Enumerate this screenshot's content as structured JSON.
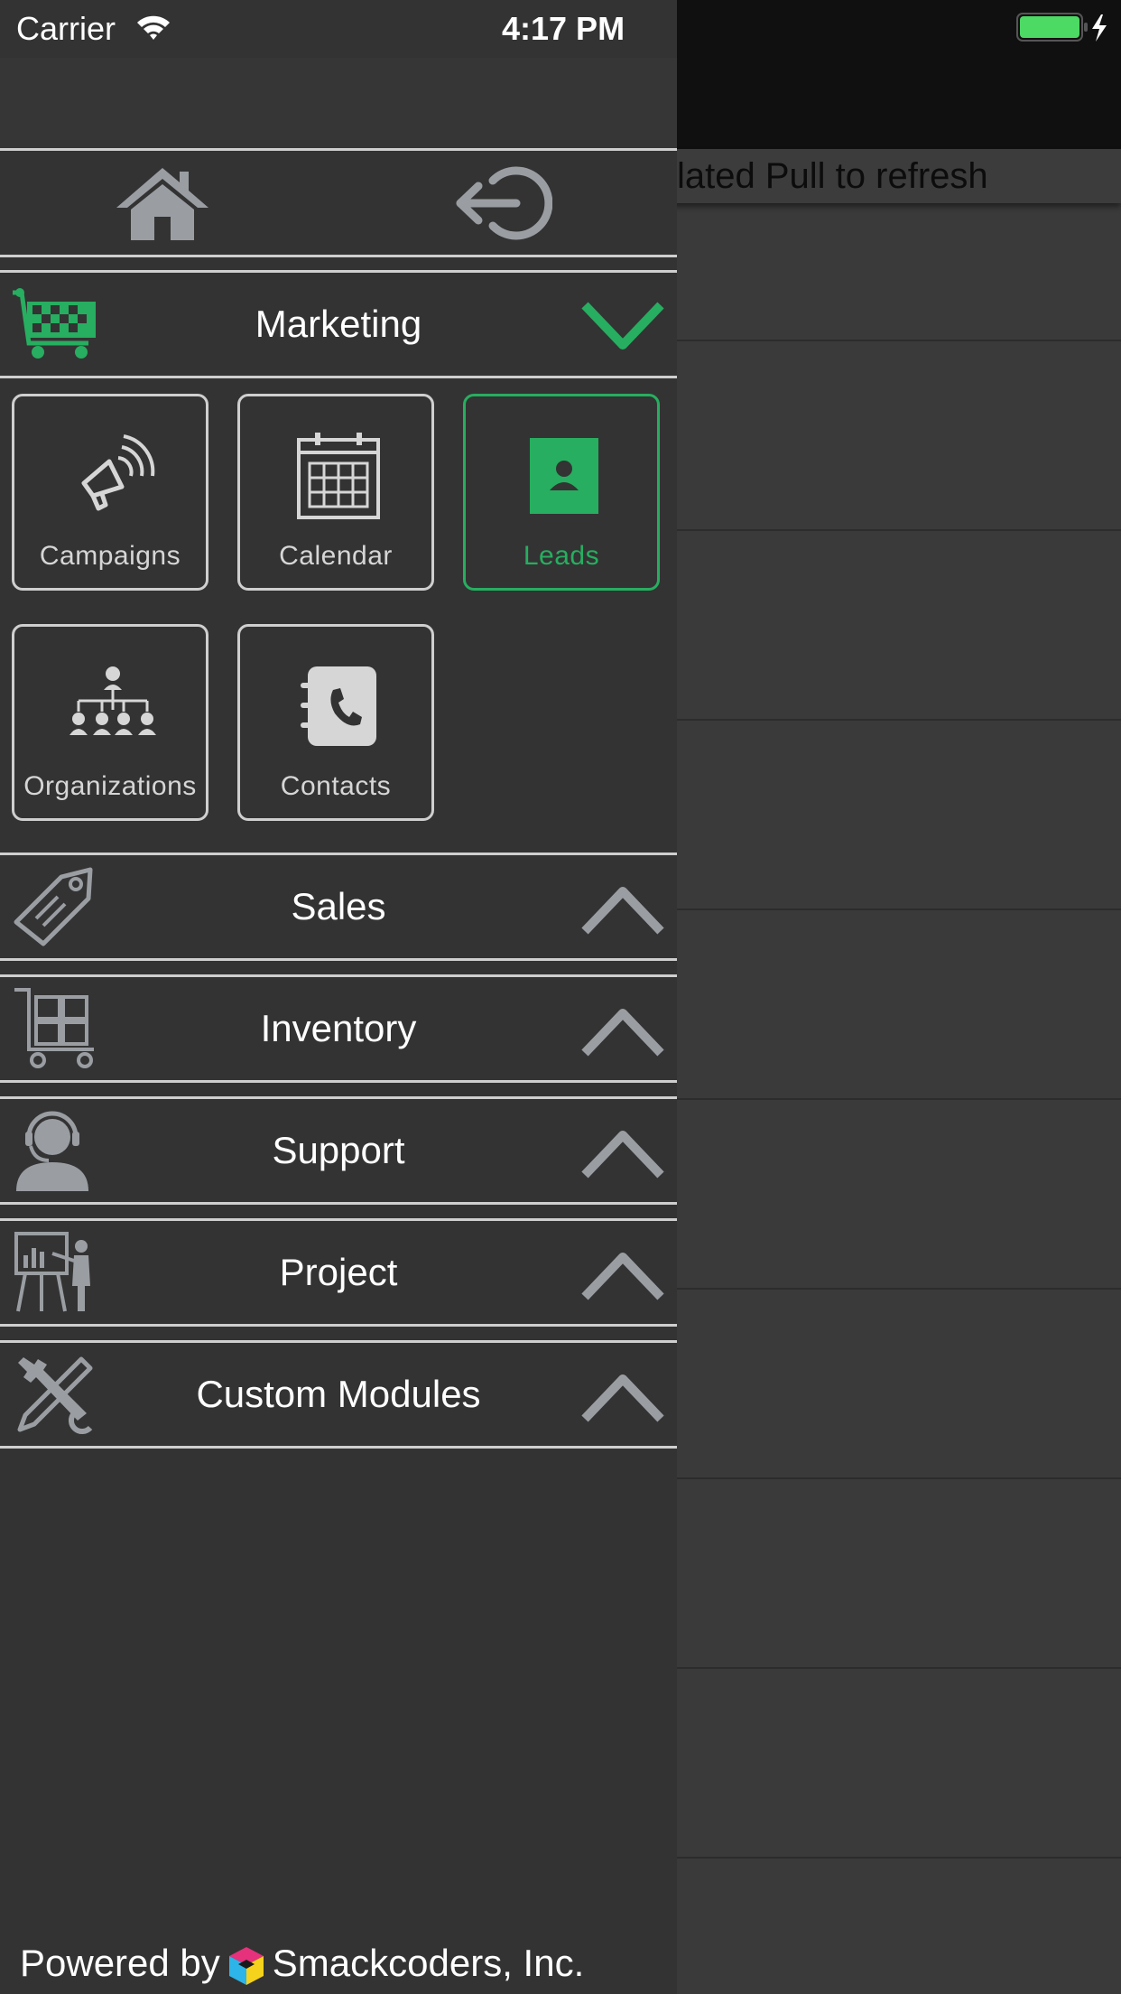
{
  "status_bar": {
    "carrier": "Carrier",
    "time": "4:17 PM",
    "battery_color": "#4cd964"
  },
  "background": {
    "refresh_text": "lated Pull to refresh"
  },
  "drawer": {
    "nav": {
      "home_icon": "home-icon",
      "logout_icon": "logout-icon"
    },
    "sections": [
      {
        "label": "Marketing",
        "icon": "shopping-cart-icon",
        "expanded": true,
        "tiles": [
          {
            "label": "Campaigns",
            "icon": "megaphone-icon",
            "active": false
          },
          {
            "label": "Calendar",
            "icon": "calendar-icon",
            "active": false
          },
          {
            "label": "Leads",
            "icon": "contact-card-icon",
            "active": true
          },
          {
            "label": "Organizations",
            "icon": "org-chart-icon",
            "active": false
          },
          {
            "label": "Contacts",
            "icon": "address-book-icon",
            "active": false
          }
        ]
      },
      {
        "label": "Sales",
        "icon": "price-tag-icon",
        "expanded": false
      },
      {
        "label": "Inventory",
        "icon": "hand-truck-icon",
        "expanded": false
      },
      {
        "label": "Support",
        "icon": "headset-agent-icon",
        "expanded": false
      },
      {
        "label": "Project",
        "icon": "presentation-icon",
        "expanded": false
      },
      {
        "label": "Custom Modules",
        "icon": "tools-icon",
        "expanded": false
      }
    ],
    "footer": {
      "powered_prefix": "Powered by",
      "company": "Smackcoders, Inc."
    }
  },
  "colors": {
    "accent": "#27ae60",
    "drawer_bg": "#333333",
    "icon_gray": "#9a9ea3",
    "divider": "#cfcfcf"
  }
}
